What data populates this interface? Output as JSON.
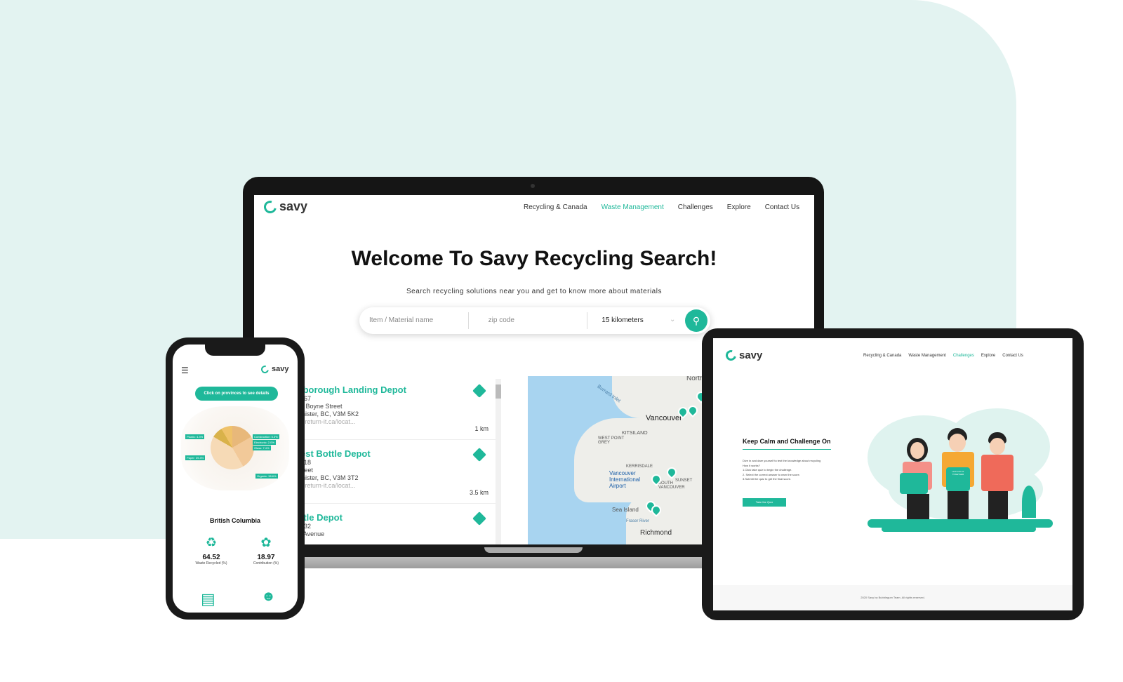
{
  "laptop": {
    "device_label": "MacBook Pro",
    "logo_text": "savy",
    "nav": [
      "Recycling & Canada",
      "Waste Management",
      "Challenges",
      "Explore",
      "Contact Us"
    ],
    "active_nav": "Waste Management",
    "hero_title": "Welcome To Savy Recycling Search!",
    "hero_subtitle": "Search recycling solutions near you and get to know more about materials",
    "search": {
      "item_placeholder": "Item / Material name",
      "zip_placeholder": "zip code",
      "radius": "15 kilometers"
    },
    "results": [
      {
        "name": "lborough Landing Depot",
        "line1": "467",
        "line2": "9 Boyne Street",
        "line3": "inister, BC, V3M 5K2",
        "url": "v.return-it.ca/locat...",
        "distance": "1 km"
      },
      {
        "name": "est Bottle Depot",
        "line1": "018",
        "line2": "treet",
        "line3": "inister, BC, V3M 3T2",
        "url": "v.return-it.ca/locat...",
        "distance": "3.5 km"
      },
      {
        "name": "ttle Depot",
        "line1": "432",
        "line2": "' Avenue",
        "line3": "",
        "url": "",
        "distance": ""
      }
    ],
    "map_labels": [
      "North Vancouver",
      "Vancouver",
      "Burrard Inlet",
      "KITSILANO",
      "WEST POINT GREY",
      "KERRISDALE",
      "SOUTH VANCOUVER",
      "SUNSET",
      "Vancouver International Airport",
      "Sea Island",
      "Fraser River",
      "Richmond"
    ]
  },
  "phone": {
    "logo_text": "savy",
    "menu_icon": "hamburger-icon",
    "button": "Click on provinces to see details",
    "pie_tags": [
      "Plastic: 4.3%",
      "Paper: 39.4%",
      "Construction: 5.3%",
      "Electronic: 2.0%",
      "Glass: 7.4%",
      "Organic: 38.6%"
    ],
    "province": "British Columbia",
    "stats": [
      {
        "value": "64.52",
        "label": "Waste Recycled (%)"
      },
      {
        "value": "18.97",
        "label": "Contribution (%)"
      }
    ]
  },
  "tablet": {
    "logo_text": "savy",
    "nav": [
      "Recycling & Canada",
      "Waste Management",
      "Challenges",
      "Explore",
      "Contact Us"
    ],
    "active_nav": "Challenges",
    "title": "Keep Calm and Challenge On",
    "intro": "Dive in and dare yourself to test the knowledge about recycling",
    "how": "How it works?",
    "steps": [
      "1.Click take quiz to begin the challenge.",
      "2. Select the correct answer to earn the score.",
      "3.Submit the quiz to get the final score."
    ],
    "button": "Take the Quiz",
    "sign_text": "LET'S DO IT TOGETHER",
    "footer": "2020 Savy by Bubblegum Team. All rights reserved."
  },
  "colors": {
    "accent": "#1fb89a",
    "background": "#e3f3f1"
  }
}
